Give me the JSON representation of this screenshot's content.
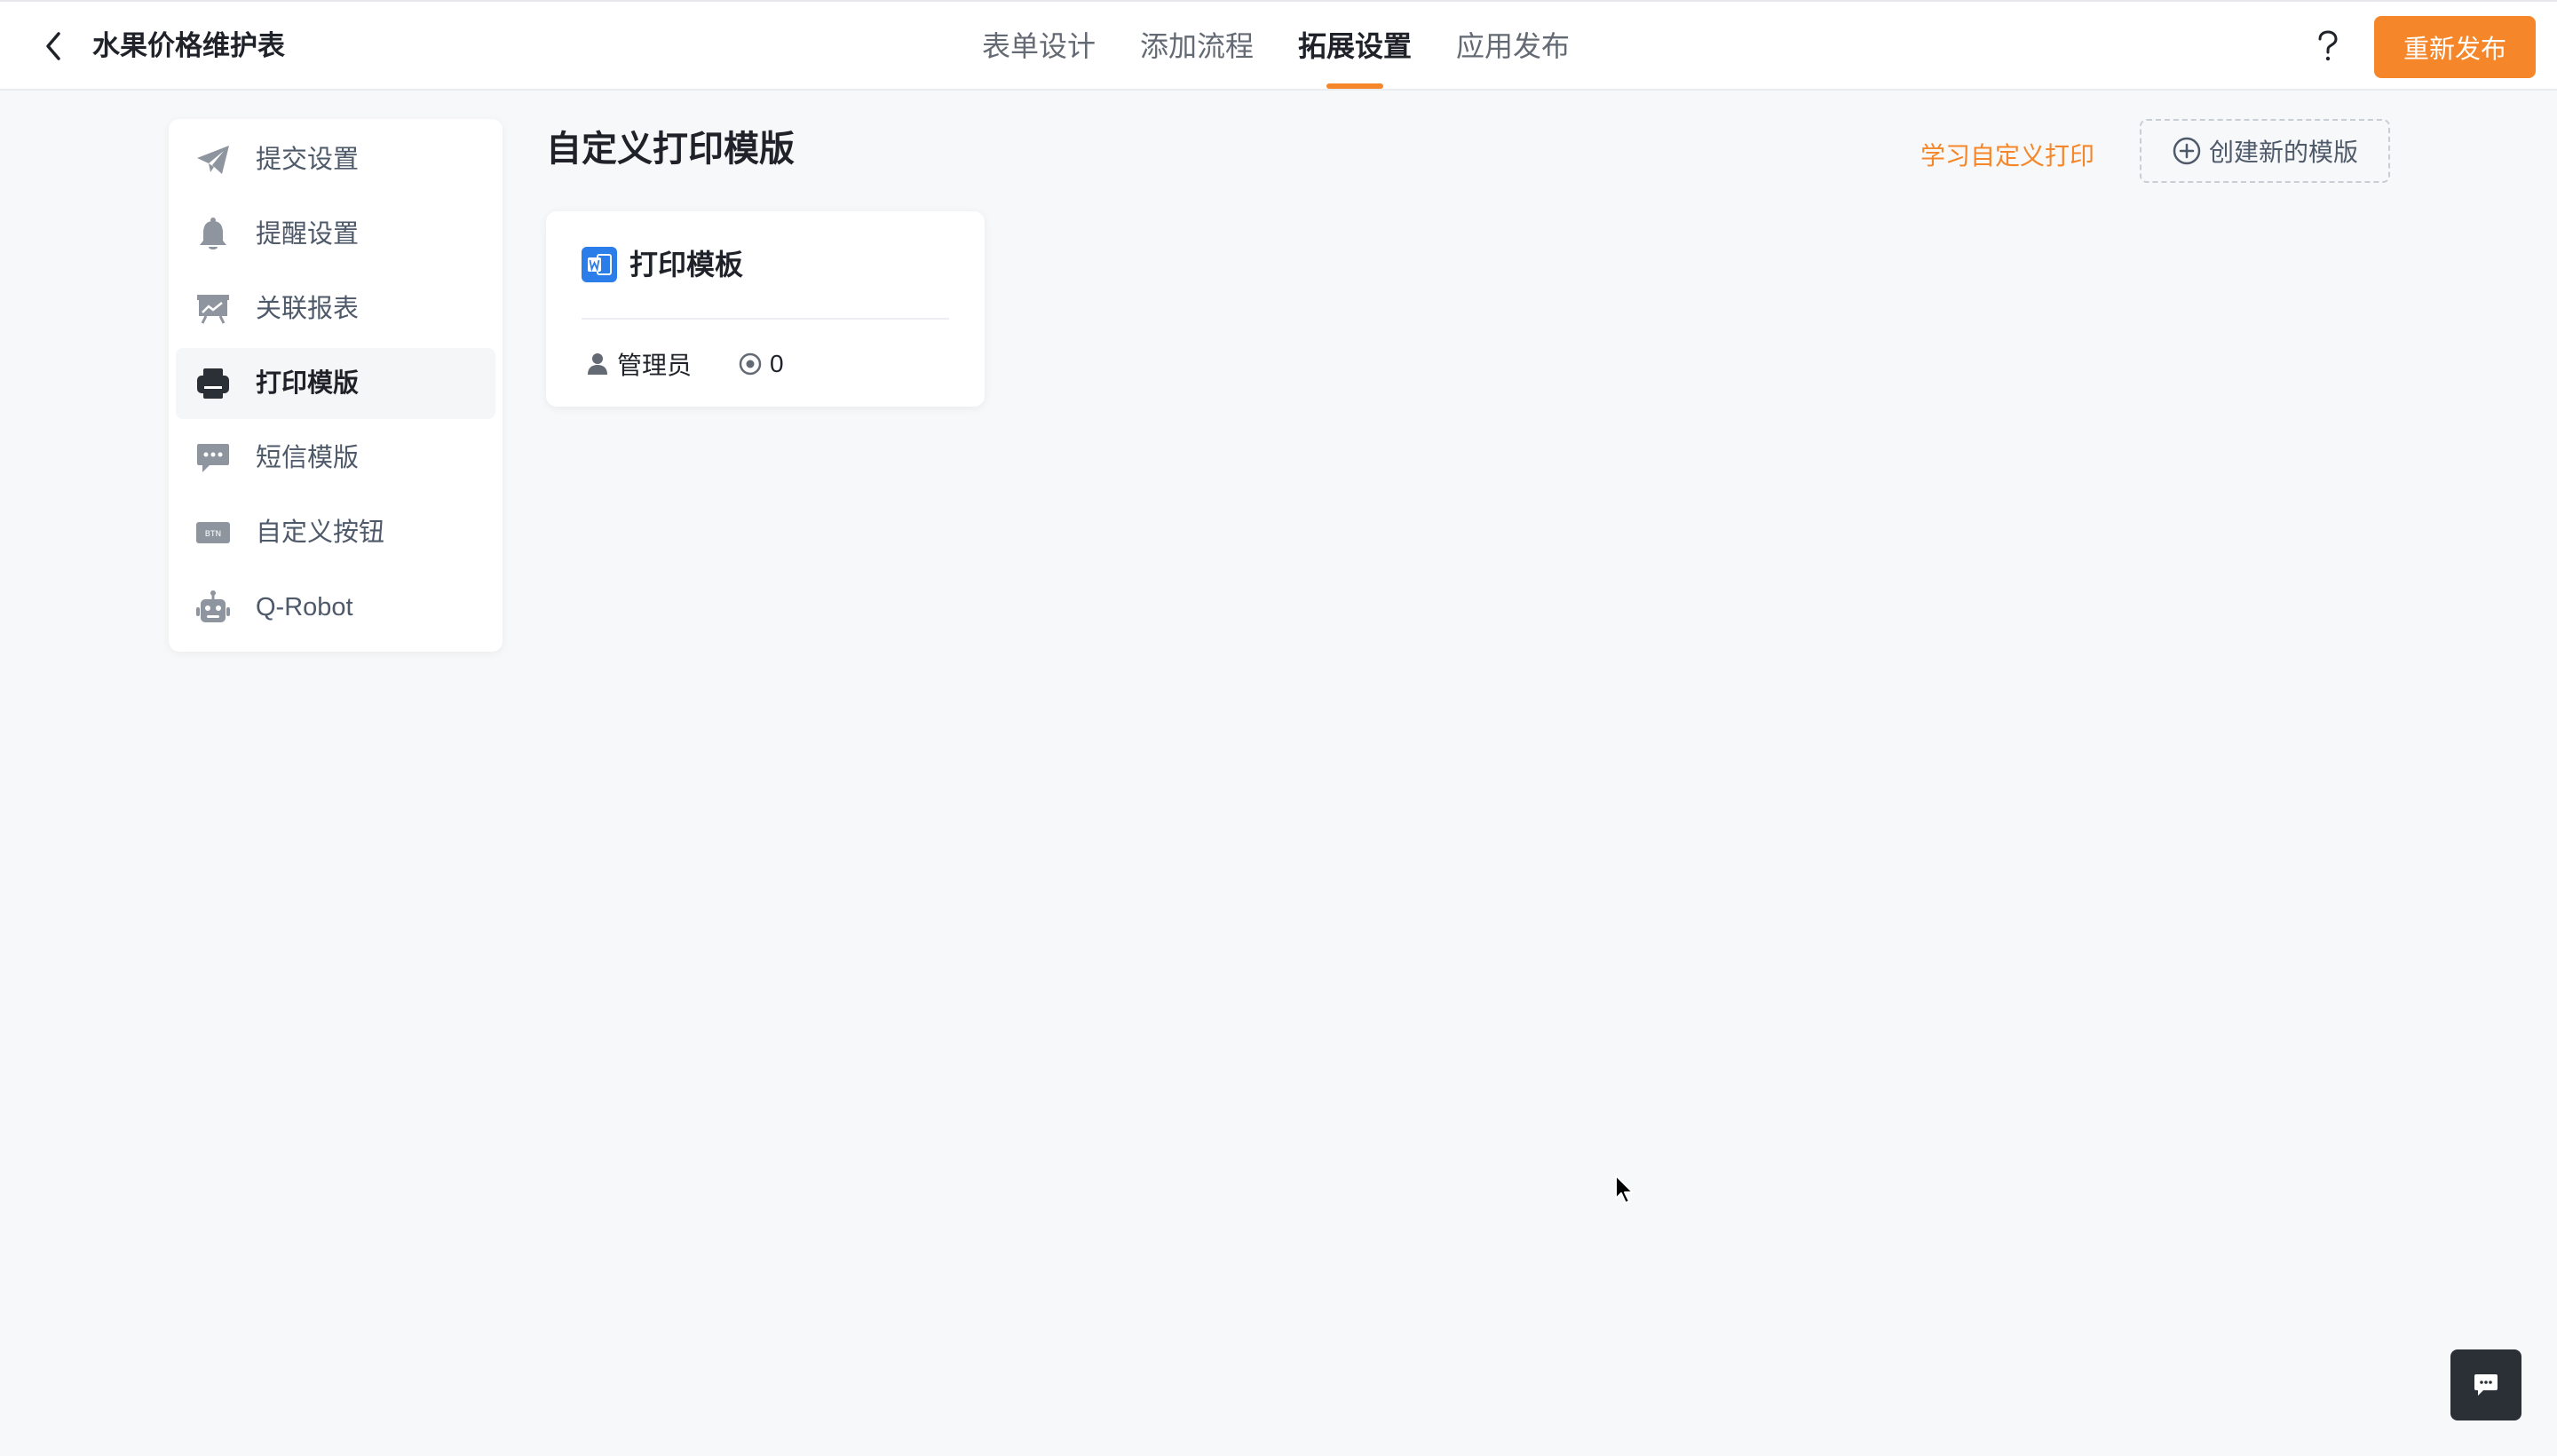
{
  "header": {
    "app_title": "水果价格维护表",
    "tabs": [
      {
        "label": "表单设计",
        "active": false
      },
      {
        "label": "添加流程",
        "active": false
      },
      {
        "label": "拓展设置",
        "active": true
      },
      {
        "label": "应用发布",
        "active": false
      }
    ],
    "help_label": "?",
    "republish_label": "重新发布"
  },
  "sidebar": {
    "items": [
      {
        "label": "提交设置",
        "icon": "paper-plane-icon",
        "active": false
      },
      {
        "label": "提醒设置",
        "icon": "bell-icon",
        "active": false
      },
      {
        "label": "关联报表",
        "icon": "report-board-icon",
        "active": false
      },
      {
        "label": "打印模版",
        "icon": "printer-icon",
        "active": true
      },
      {
        "label": "短信模版",
        "icon": "message-icon",
        "active": false
      },
      {
        "label": "自定义按钮",
        "icon": "btn-icon",
        "active": false
      },
      {
        "label": "Q-Robot",
        "icon": "robot-icon",
        "active": false
      }
    ],
    "btn_icon_text": "BTN"
  },
  "main": {
    "title": "自定义打印模版",
    "learn_link": "学习自定义打印",
    "create_button": "创建新的模版",
    "cards": [
      {
        "title": "打印模板",
        "icon": "word-document-icon",
        "owner": "管理员",
        "count": "0"
      }
    ]
  },
  "colors": {
    "accent": "#f5872a",
    "background": "#f7f8f9",
    "card": "#ffffff",
    "text_primary": "#1f2329",
    "text_secondary": "#646a73",
    "icon_gray": "#8f959e",
    "doc_blue": "#2b7de9",
    "chat_dark": "#2b2f36"
  }
}
